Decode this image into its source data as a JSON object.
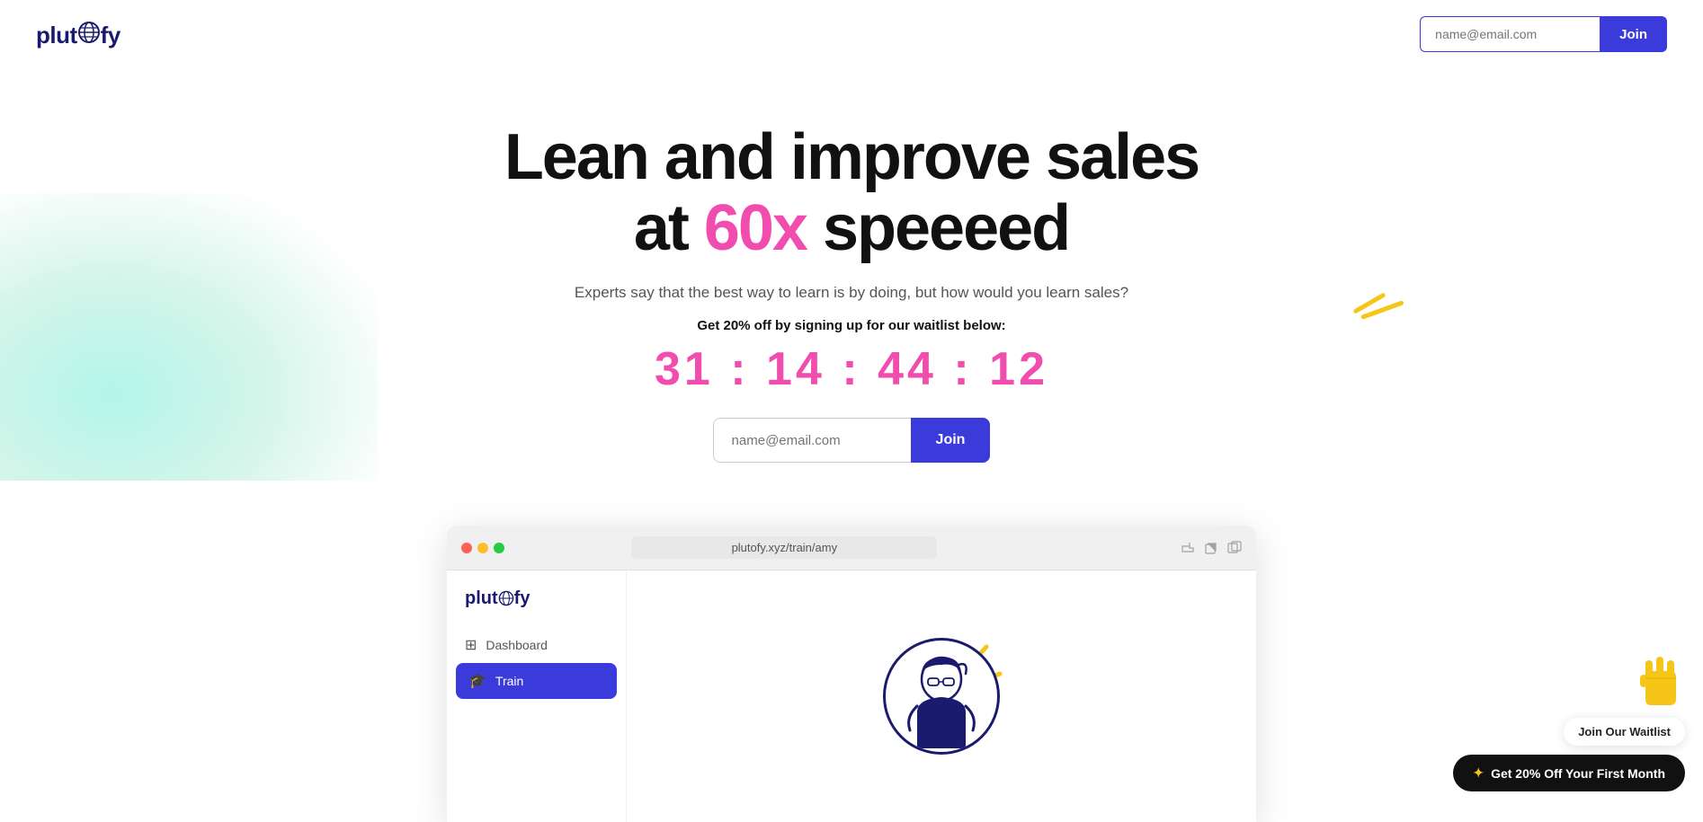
{
  "brand": {
    "name": "plutofy",
    "globe_char": "🌍"
  },
  "nav": {
    "email_placeholder": "name@email.com",
    "join_label": "Join"
  },
  "hero": {
    "title_line1": "Lean and improve sales",
    "title_line2_prefix": "at ",
    "title_line2_accent": "60x",
    "title_line2_suffix": " speeeed",
    "subtitle": "Experts say that the best way to learn is by doing, but how would you learn sales?",
    "cta_label": "Get 20% off by signing up for our waitlist below:",
    "countdown": "31 : 14 : 44 : 12",
    "email_placeholder": "name@email.com",
    "join_label": "Join"
  },
  "mockup": {
    "url": "plutofy.xyz/train/amy",
    "sidebar": {
      "logo": "plutofy",
      "dashboard_label": "Dashboard",
      "train_label": "Train"
    }
  },
  "floating": {
    "waitlist_label": "Join Our Waitlist",
    "cta_label": "Get 20% Off Your First Month",
    "star": "✦"
  }
}
